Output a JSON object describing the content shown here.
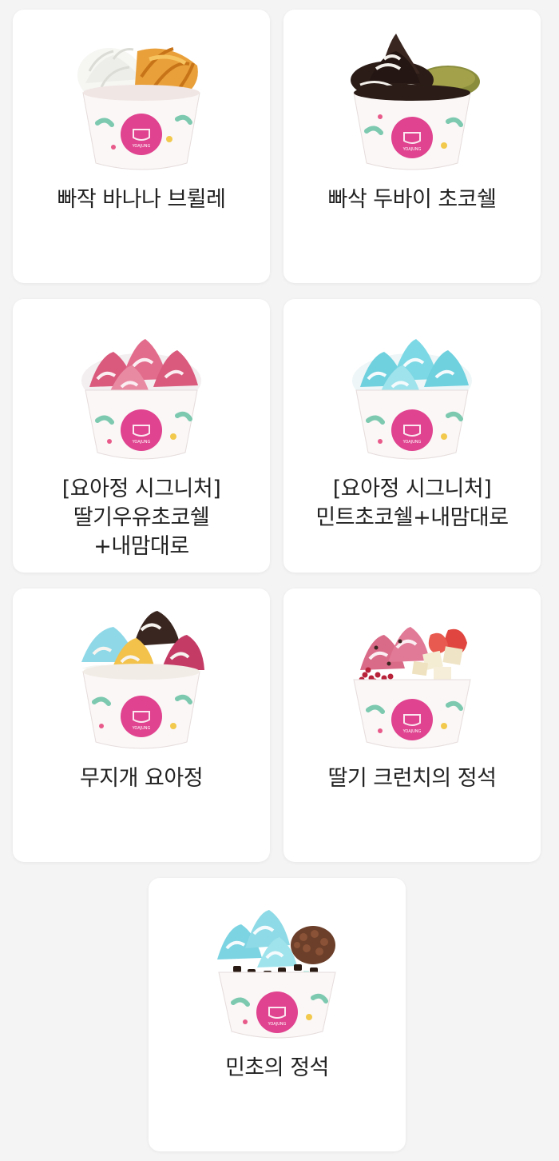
{
  "menu": {
    "items": [
      {
        "name": "빠작 바나나 브륄레",
        "topping": "banana"
      },
      {
        "name": "빠삭 두바이 초코쉘",
        "topping": "dubai-choco"
      },
      {
        "name": "[요아정 시그니처]\n딸기우유초코쉘\n+내맘대로",
        "topping": "strawberry-swirl"
      },
      {
        "name": "[요아정 시그니처]\n민트초코쉘+내맘대로",
        "topping": "mint-swirl"
      },
      {
        "name": "무지개 요아정",
        "topping": "rainbow"
      },
      {
        "name": "딸기 크런치의 정석",
        "topping": "strawberry-crunch"
      },
      {
        "name": "민초의 정석",
        "topping": "mint-choco"
      }
    ]
  },
  "brand": {
    "cup_logo_text": "YOAJUNG",
    "colors": {
      "logo_pink": "#e0438f",
      "cup_white": "#faf7f6",
      "card_bg": "#ffffff",
      "page_bg": "#f4f4f4"
    }
  }
}
